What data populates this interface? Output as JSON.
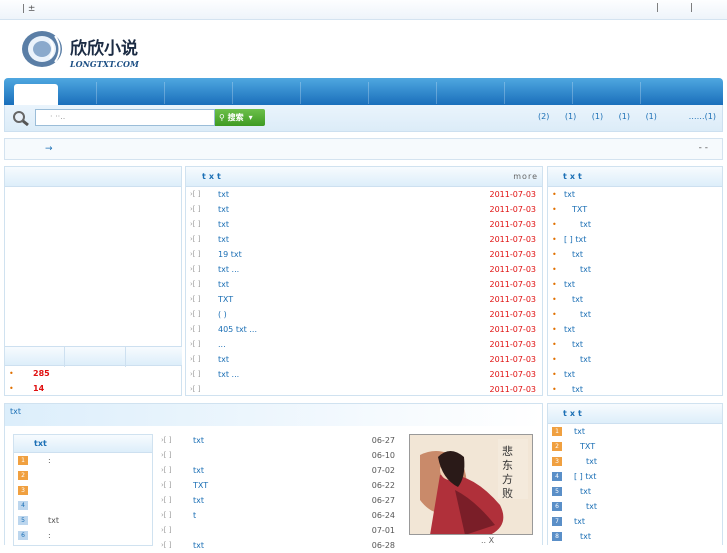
{
  "topbar": {
    "left": "| ±",
    "right": "| |"
  },
  "logo": {
    "title": "欣欣小说",
    "url": "LONGTXT.COM"
  },
  "search": {
    "placeholder": "·  ··..",
    "button": "搜索",
    "links": [
      "(2)",
      "(1)",
      "(1)",
      "(1)",
      "(1)"
    ],
    "more": "……(1)"
  },
  "notice": {
    "arrow": "→",
    "right": "-  -"
  },
  "left": {
    "stat1": "285",
    "stat2": "14"
  },
  "middle": {
    "title": "txt",
    "more": "more",
    "rows": [
      {
        "text": "txt",
        "date": "2011-07-03"
      },
      {
        "text": "txt",
        "date": "2011-07-03"
      },
      {
        "text": "txt",
        "date": "2011-07-03"
      },
      {
        "text": "txt",
        "date": "2011-07-03"
      },
      {
        "text": "19   txt",
        "date": "2011-07-03"
      },
      {
        "text": "txt  ...",
        "date": "2011-07-03"
      },
      {
        "text": "txt",
        "date": "2011-07-03"
      },
      {
        "text": "TXT",
        "date": "2011-07-03"
      },
      {
        "text": "(      )",
        "date": "2011-07-03"
      },
      {
        "text": "405   txt ...",
        "date": "2011-07-03"
      },
      {
        "text": "...",
        "date": "2011-07-03"
      },
      {
        "text": "txt",
        "date": "2011-07-03"
      },
      {
        "text": "txt ...",
        "date": "2011-07-03"
      },
      {
        "text": "",
        "date": "2011-07-03"
      }
    ]
  },
  "right": {
    "title": "txt",
    "items": [
      "txt",
      "TXT",
      "txt",
      "[  ]    txt",
      "txt",
      "txt",
      "txt",
      "txt",
      "txt",
      "txt",
      "txt",
      "txt",
      "txt",
      "txt"
    ]
  },
  "bottom": {
    "title": "txt",
    "sub_title": "txt",
    "sub_items": [
      "1",
      "2",
      "3",
      "4",
      "5",
      "6"
    ],
    "sub_texts": [
      ":",
      "",
      "",
      "",
      "txt",
      ":"
    ],
    "rows": [
      {
        "text": "txt",
        "date": "06-27"
      },
      {
        "text": "",
        "date": "06-10"
      },
      {
        "text": "txt",
        "date": "07-02"
      },
      {
        "text": "TXT",
        "date": "06-22"
      },
      {
        "text": "txt",
        "date": "06-27"
      },
      {
        "text": "t",
        "date": "06-24"
      },
      {
        "text": "",
        "date": "07-01"
      },
      {
        "text": "txt",
        "date": "06-28"
      }
    ],
    "cover_caption": "..          X"
  },
  "right2": {
    "title": "txt",
    "items": [
      "txt",
      "TXT",
      "txt",
      "[  ]    txt",
      "txt",
      "txt",
      "txt",
      "txt"
    ],
    "nums": [
      "1",
      "2",
      "3",
      "4",
      "5",
      "6",
      "7",
      "8"
    ]
  },
  "colors": {
    "accent": "#1b6fb5",
    "date": "#e01010",
    "nav": "#1a6fbb"
  }
}
